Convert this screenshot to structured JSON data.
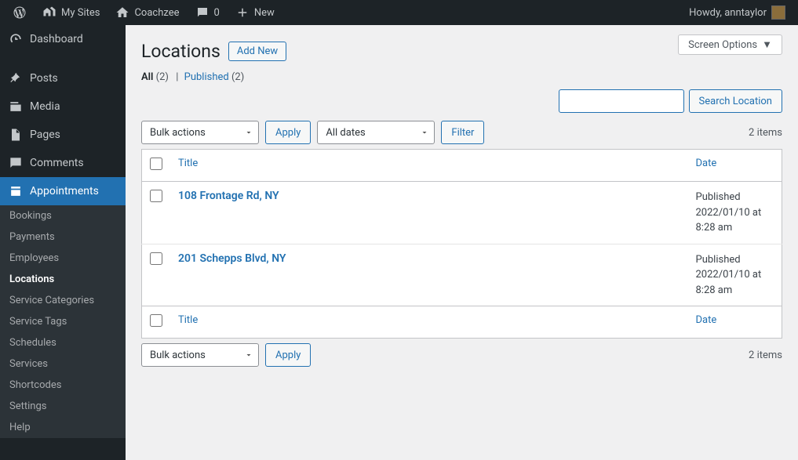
{
  "adminbar": {
    "my_sites": "My Sites",
    "site_name": "Coachzee",
    "comments_count": "0",
    "new_label": "New",
    "greeting": "Howdy, anntaylor"
  },
  "sidebar": {
    "items": [
      {
        "label": "Dashboard"
      },
      {
        "label": "Posts"
      },
      {
        "label": "Media"
      },
      {
        "label": "Pages"
      },
      {
        "label": "Comments"
      },
      {
        "label": "Appointments"
      }
    ],
    "submenu": [
      {
        "label": "Bookings"
      },
      {
        "label": "Payments"
      },
      {
        "label": "Employees"
      },
      {
        "label": "Locations"
      },
      {
        "label": "Service Categories"
      },
      {
        "label": "Service Tags"
      },
      {
        "label": "Schedules"
      },
      {
        "label": "Services"
      },
      {
        "label": "Shortcodes"
      },
      {
        "label": "Settings"
      },
      {
        "label": "Help"
      }
    ]
  },
  "screen_options_label": "Screen Options",
  "page": {
    "title": "Locations",
    "add_new": "Add New"
  },
  "filters": {
    "all_label": "All",
    "all_count": "(2)",
    "published_label": "Published",
    "published_count": "(2)"
  },
  "search": {
    "button": "Search Location"
  },
  "bulk": {
    "bulk_actions": "Bulk actions",
    "apply": "Apply",
    "all_dates": "All dates",
    "filter": "Filter",
    "items_count": "2 items"
  },
  "table": {
    "col_title": "Title",
    "col_date": "Date",
    "rows": [
      {
        "title": "108 Frontage Rd, NY",
        "status": "Published",
        "when": "2022/01/10 at 8:28 am"
      },
      {
        "title": "201 Schepps Blvd, NY",
        "status": "Published",
        "when": "2022/01/10 at 8:28 am"
      }
    ]
  }
}
